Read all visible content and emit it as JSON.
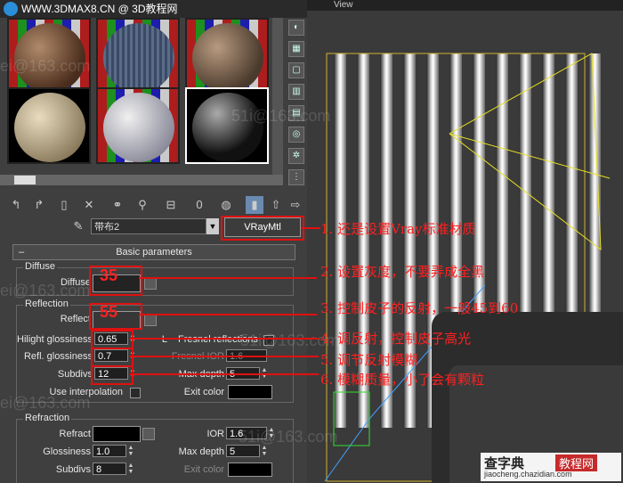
{
  "window": {
    "site_title": "WWW.3DMAX8.CN @ 3D教程网",
    "viewport_label": "View"
  },
  "material_editor": {
    "material_name": "带布2",
    "material_type": "VRayMtl",
    "rollout_title": "Basic parameters",
    "rollout_toggle": "–",
    "diffuse": {
      "group_title": "Diffuse",
      "diffuse_label": "Diffuse"
    },
    "reflection": {
      "group_title": "Reflection",
      "reflect_label": "Reflect",
      "hilight_glossiness_label": "Hilight glossiness",
      "hilight_glossiness_value": "0.65",
      "lock_label": "L",
      "fresnel_label": "Fresnel reflections",
      "refl_glossiness_label": "Refl. glossiness",
      "refl_glossiness_value": "0.7",
      "fresnel_ior_label": "Fresnel IOR",
      "fresnel_ior_value": "1.6",
      "subdivs_label": "Subdivs",
      "subdivs_value": "12",
      "max_depth_label": "Max depth",
      "max_depth_value": "5",
      "use_interp_label": "Use interpolation",
      "exit_color_label": "Exit color"
    },
    "refraction": {
      "group_title": "Refraction",
      "refract_label": "Refract",
      "ior_label": "IOR",
      "ior_value": "1.6",
      "glossiness_label": "Glossiness",
      "glossiness_value": "1.0",
      "max_depth_label": "Max depth",
      "max_depth_value": "5",
      "subdivs_label": "Subdivs",
      "subdivs_value": "8",
      "exit_color_label": "Exit color"
    }
  },
  "red_values": {
    "diffuse_value": "35",
    "reflect_value": "55"
  },
  "annotations": [
    "1. 还是设置Vray标准材质",
    "2. 设置灰度，不要弄成全黑",
    "3. 控制皮子的反射，一般45到60",
    "4. 调反射，控制皮子高光",
    "5. 调节反射模糊",
    "6. 模糊质量，小了会有颗粒"
  ],
  "watermarks": [
    "ei@163.com",
    "51i@163.com",
    "ei@163.com",
    "51i@163.com",
    "ei@163.com",
    "51i@163.com"
  ],
  "brand": {
    "name": "查字典",
    "tag": "教程网",
    "url": "jiaocheng.chazidian.com"
  },
  "colors": {
    "annotation_red": "#ff2020",
    "panel_bg": "#3f3f3f",
    "exit_color": "#000000"
  }
}
